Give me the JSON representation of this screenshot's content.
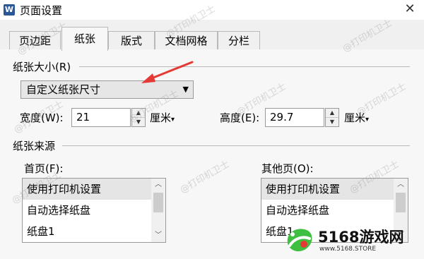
{
  "window": {
    "title": "页面设置",
    "app_icon": "W"
  },
  "tabs": [
    {
      "label": "页边距"
    },
    {
      "label": "纸张"
    },
    {
      "label": "版式"
    },
    {
      "label": "文档网格"
    },
    {
      "label": "分栏"
    }
  ],
  "active_tab": "纸张",
  "paper_size": {
    "group_label": "纸张大小(R)",
    "selected": "自定义纸张尺寸",
    "width_label": "宽度(W):",
    "width_value": "21",
    "width_unit": "厘米",
    "height_label": "高度(E):",
    "height_value": "29.7",
    "height_unit": "厘米"
  },
  "paper_source": {
    "group_label": "纸张来源",
    "first_page_label": "首页(F):",
    "other_pages_label": "其他页(O):",
    "first_page_items": [
      "使用打印机设置",
      "自动选择纸盘",
      "纸盘1"
    ],
    "other_pages_items": [
      "使用打印机设置",
      "自动选择纸盘",
      "纸盘1"
    ],
    "first_page_selected": "使用打印机设置",
    "other_pages_selected": "使用打印机设置"
  },
  "watermark": {
    "text": "@打印机卫士"
  },
  "logo": {
    "name": "5168游戏网",
    "url": "www.5168.STORE"
  },
  "colors": {
    "annotation_arrow": "#e53935",
    "selection": "#e5e5e5",
    "logo_green": "#3fbf3f",
    "logo_red": "#e53935"
  }
}
